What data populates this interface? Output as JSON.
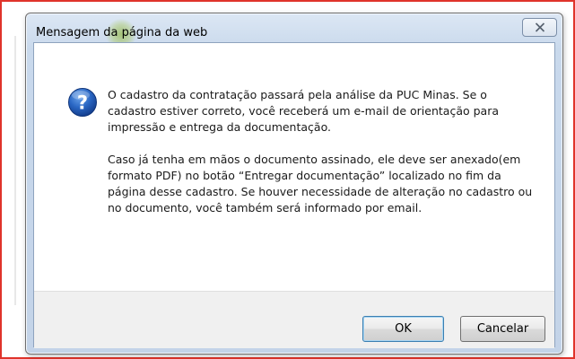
{
  "dialog": {
    "title": "Mensagem da página da web",
    "close_glyph": "☒"
  },
  "message": {
    "icon": "question-icon",
    "paragraph_1": "O cadastro da contratação passará pela análise da PUC Minas. Se o cadastro estiver correto, você receberá um e-mail de orientação para impressão e entrega da documentação.",
    "paragraph_2": "Caso já tenha em mãos o documento assinado, ele deve ser anexado(em formato PDF) no botão “Entregar documentação” localizado no fim da página desse cadastro. Se houver necessidade de alteração no cadastro ou no documento, você também será informado por email."
  },
  "buttons": {
    "ok_label": "OK",
    "cancel_label": "Cancelar"
  },
  "colors": {
    "annotation_border": "#e0342b",
    "titlebar": "#c9d9ec",
    "icon_blue": "#1f5fb4"
  }
}
